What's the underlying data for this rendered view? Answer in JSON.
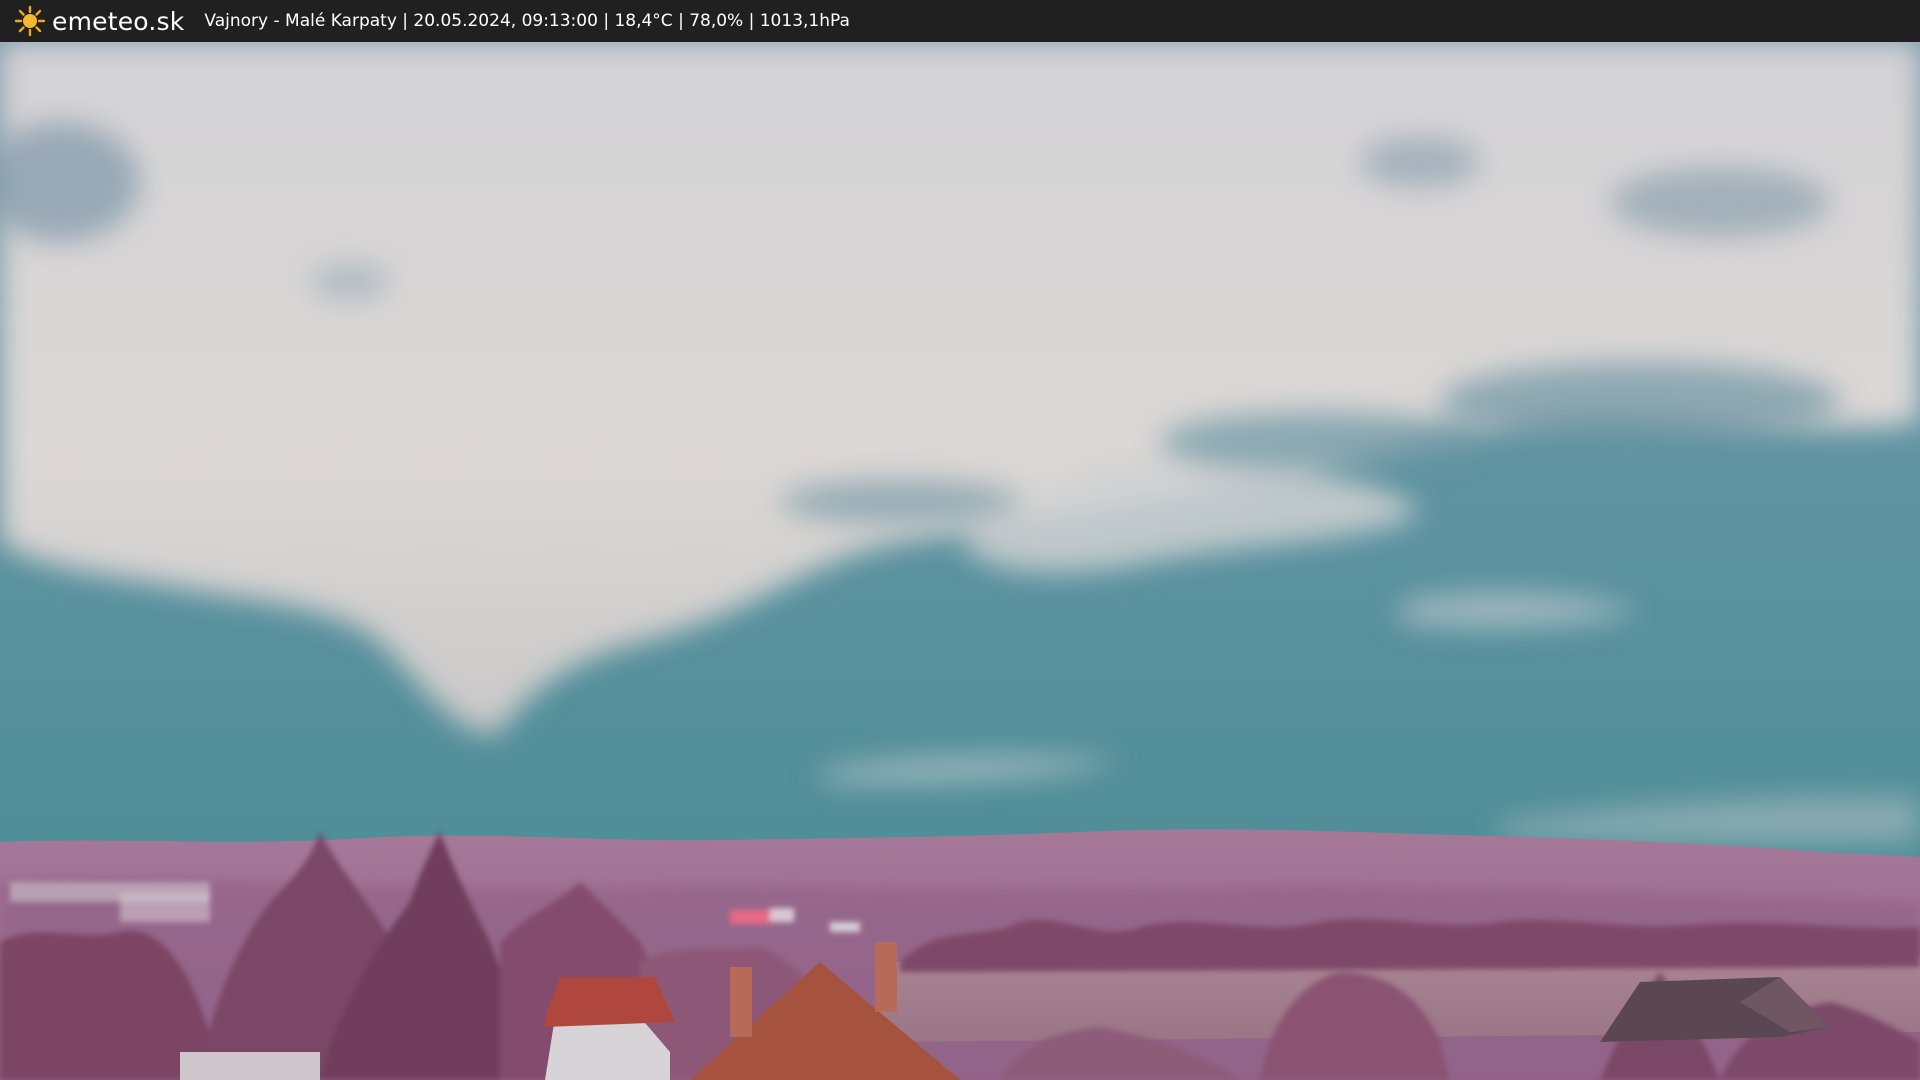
{
  "header": {
    "brand": "emeteo.sk",
    "info": "Vajnory - Malé Karpaty | 20.05.2024, 09:13:00 | 18,4°C | 78,0% | 1013,1hPa"
  },
  "icons": {
    "logo": "sun-icon"
  },
  "colors": {
    "bar_bg": "#202020",
    "sun": "#f5a623",
    "sky_top": "#7a98a8",
    "sky_bottom": "#4f8f97",
    "clouds": "#d9d6d6",
    "hills": "#9c6a8f",
    "foliage": "#8a5470"
  }
}
